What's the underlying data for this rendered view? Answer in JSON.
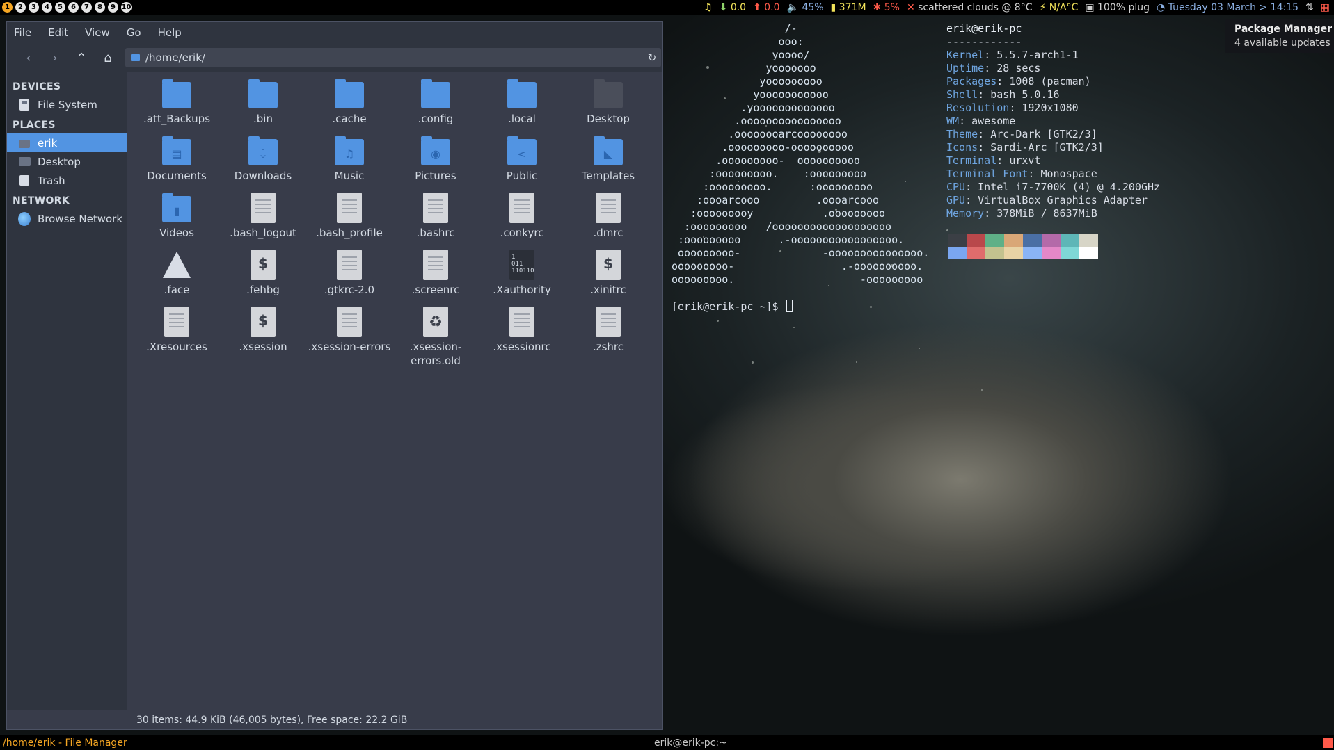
{
  "topbar": {
    "tags": [
      "1",
      "2",
      "3",
      "4",
      "5",
      "6",
      "7",
      "8",
      "9",
      "10"
    ],
    "active_tag": "1",
    "status": {
      "music_icon": "music-note-icon",
      "net_down": "0.0",
      "net_up": "0.0",
      "volume": "45%",
      "memory": "371M",
      "cpu": "5%",
      "weather": "scattered clouds @ 8°C",
      "temp": "N/A°C",
      "battery": "100% plug",
      "datetime": "Tuesday 03 March > 14:15"
    }
  },
  "file_manager": {
    "menu": [
      "File",
      "Edit",
      "View",
      "Go",
      "Help"
    ],
    "path": "/home/erik/",
    "sidebar": {
      "devices_heading": "DEVICES",
      "devices": [
        {
          "label": "File System",
          "icon": "drive-icon"
        }
      ],
      "places_heading": "PLACES",
      "places": [
        {
          "label": "erik",
          "icon": "home-icon",
          "selected": true
        },
        {
          "label": "Desktop",
          "icon": "folder-icon"
        },
        {
          "label": "Trash",
          "icon": "trash-icon"
        }
      ],
      "network_heading": "NETWORK",
      "network": [
        {
          "label": "Browse Network",
          "icon": "network-globe-icon"
        }
      ]
    },
    "items": [
      {
        "name": ".att_Backups",
        "type": "folder"
      },
      {
        "name": ".bin",
        "type": "folder"
      },
      {
        "name": ".cache",
        "type": "folder"
      },
      {
        "name": ".config",
        "type": "folder"
      },
      {
        "name": ".local",
        "type": "folder"
      },
      {
        "name": "Desktop",
        "type": "folder-dark"
      },
      {
        "name": "Documents",
        "type": "folder",
        "glyph": "▤"
      },
      {
        "name": "Downloads",
        "type": "folder",
        "glyph": "⇩"
      },
      {
        "name": "Music",
        "type": "folder",
        "glyph": "♫"
      },
      {
        "name": "Pictures",
        "type": "folder",
        "glyph": "◉"
      },
      {
        "name": "Public",
        "type": "folder",
        "glyph": "<"
      },
      {
        "name": "Templates",
        "type": "folder",
        "glyph": "◣"
      },
      {
        "name": "Videos",
        "type": "folder",
        "glyph": "▮"
      },
      {
        "name": ".bash_logout",
        "type": "text"
      },
      {
        "name": ".bash_profile",
        "type": "text"
      },
      {
        "name": ".bashrc",
        "type": "text"
      },
      {
        "name": ".conkyrc",
        "type": "text"
      },
      {
        "name": ".dmrc",
        "type": "text"
      },
      {
        "name": ".face",
        "type": "arch"
      },
      {
        "name": ".fehbg",
        "type": "script"
      },
      {
        "name": ".gtkrc-2.0",
        "type": "text"
      },
      {
        "name": ".screenrc",
        "type": "text"
      },
      {
        "name": ".Xauthority",
        "type": "binary"
      },
      {
        "name": ".xinitrc",
        "type": "script"
      },
      {
        "name": ".Xresources",
        "type": "text"
      },
      {
        "name": ".xsession",
        "type": "script"
      },
      {
        "name": ".xsession-errors",
        "type": "text"
      },
      {
        "name": ".xsession-errors.old",
        "type": "recycle"
      },
      {
        "name": ".xsessionrc",
        "type": "text"
      },
      {
        "name": ".zshrc",
        "type": "text"
      }
    ],
    "statusbar": "30 items: 44.9 KiB (46,005 bytes), Free space: 22.2 GiB"
  },
  "terminal": {
    "logo": "                  /-\n                 ooo:\n                yoooo/\n               yooooooo\n              yooooooooo\n             yooooooooooo\n           .yooooooooooooo\n          .oooooooooooooooo\n         .oooooooarcoooooooo\n        .ooooooooo-oooooooooo\n       .ooooooooo-  oooooooooo\n      :ooooooooo.    :ooooooooo\n     :ooooooooo.      :ooooooooo\n    :oooarcooo         .oooarcooo\n   :ooooooooy           .ooooooooo\n  :ooooooooo   /ooooooooooooooooooo\n :ooooooooo      .-ooooooooooooooooo.\n ooooooooo-             -ooooooooooooooo.\nooooooooo-                 .-oooooooooo.\nooooooooo.                    -ooooooooo",
    "host": "erik@erik-pc",
    "separator": "------------",
    "info": [
      {
        "key": "Kernel",
        "value": "5.5.7-arch1-1"
      },
      {
        "key": "Uptime",
        "value": "28 secs"
      },
      {
        "key": "Packages",
        "value": "1008 (pacman)"
      },
      {
        "key": "Shell",
        "value": "bash 5.0.16"
      },
      {
        "key": "Resolution",
        "value": "1920x1080"
      },
      {
        "key": "WM",
        "value": "awesome"
      },
      {
        "key": "Theme",
        "value": "Arc-Dark [GTK2/3]"
      },
      {
        "key": "Icons",
        "value": "Sardi-Arc [GTK2/3]"
      },
      {
        "key": "Terminal",
        "value": "urxvt"
      },
      {
        "key": "Terminal Font",
        "value": "Monospace"
      },
      {
        "key": "CPU",
        "value": "Intel i7-7700K (4) @ 4.200GHz"
      },
      {
        "key": "GPU",
        "value": "VirtualBox Graphics Adapter"
      },
      {
        "key": "Memory",
        "value": "378MiB / 8637MiB"
      }
    ],
    "palette": [
      "#3b3f45",
      "#b9484b",
      "#5fb087",
      "#d9a777",
      "#4a6fa4",
      "#b46aa9",
      "#5eb6b7",
      "#d7d5c7",
      "#7aa6f0",
      "#e06c6c",
      "#c3c28f",
      "#e8d3a5",
      "#8ab4f5",
      "#e488c8",
      "#7fd7d6",
      "#ffffff"
    ],
    "prompt": "[erik@erik-pc ~]$ "
  },
  "notification": {
    "title": "Package Manager",
    "body": "4 available updates"
  },
  "bottombar": {
    "left": "/home/erik - File Manager",
    "middle": "erik@erik-pc:~"
  }
}
